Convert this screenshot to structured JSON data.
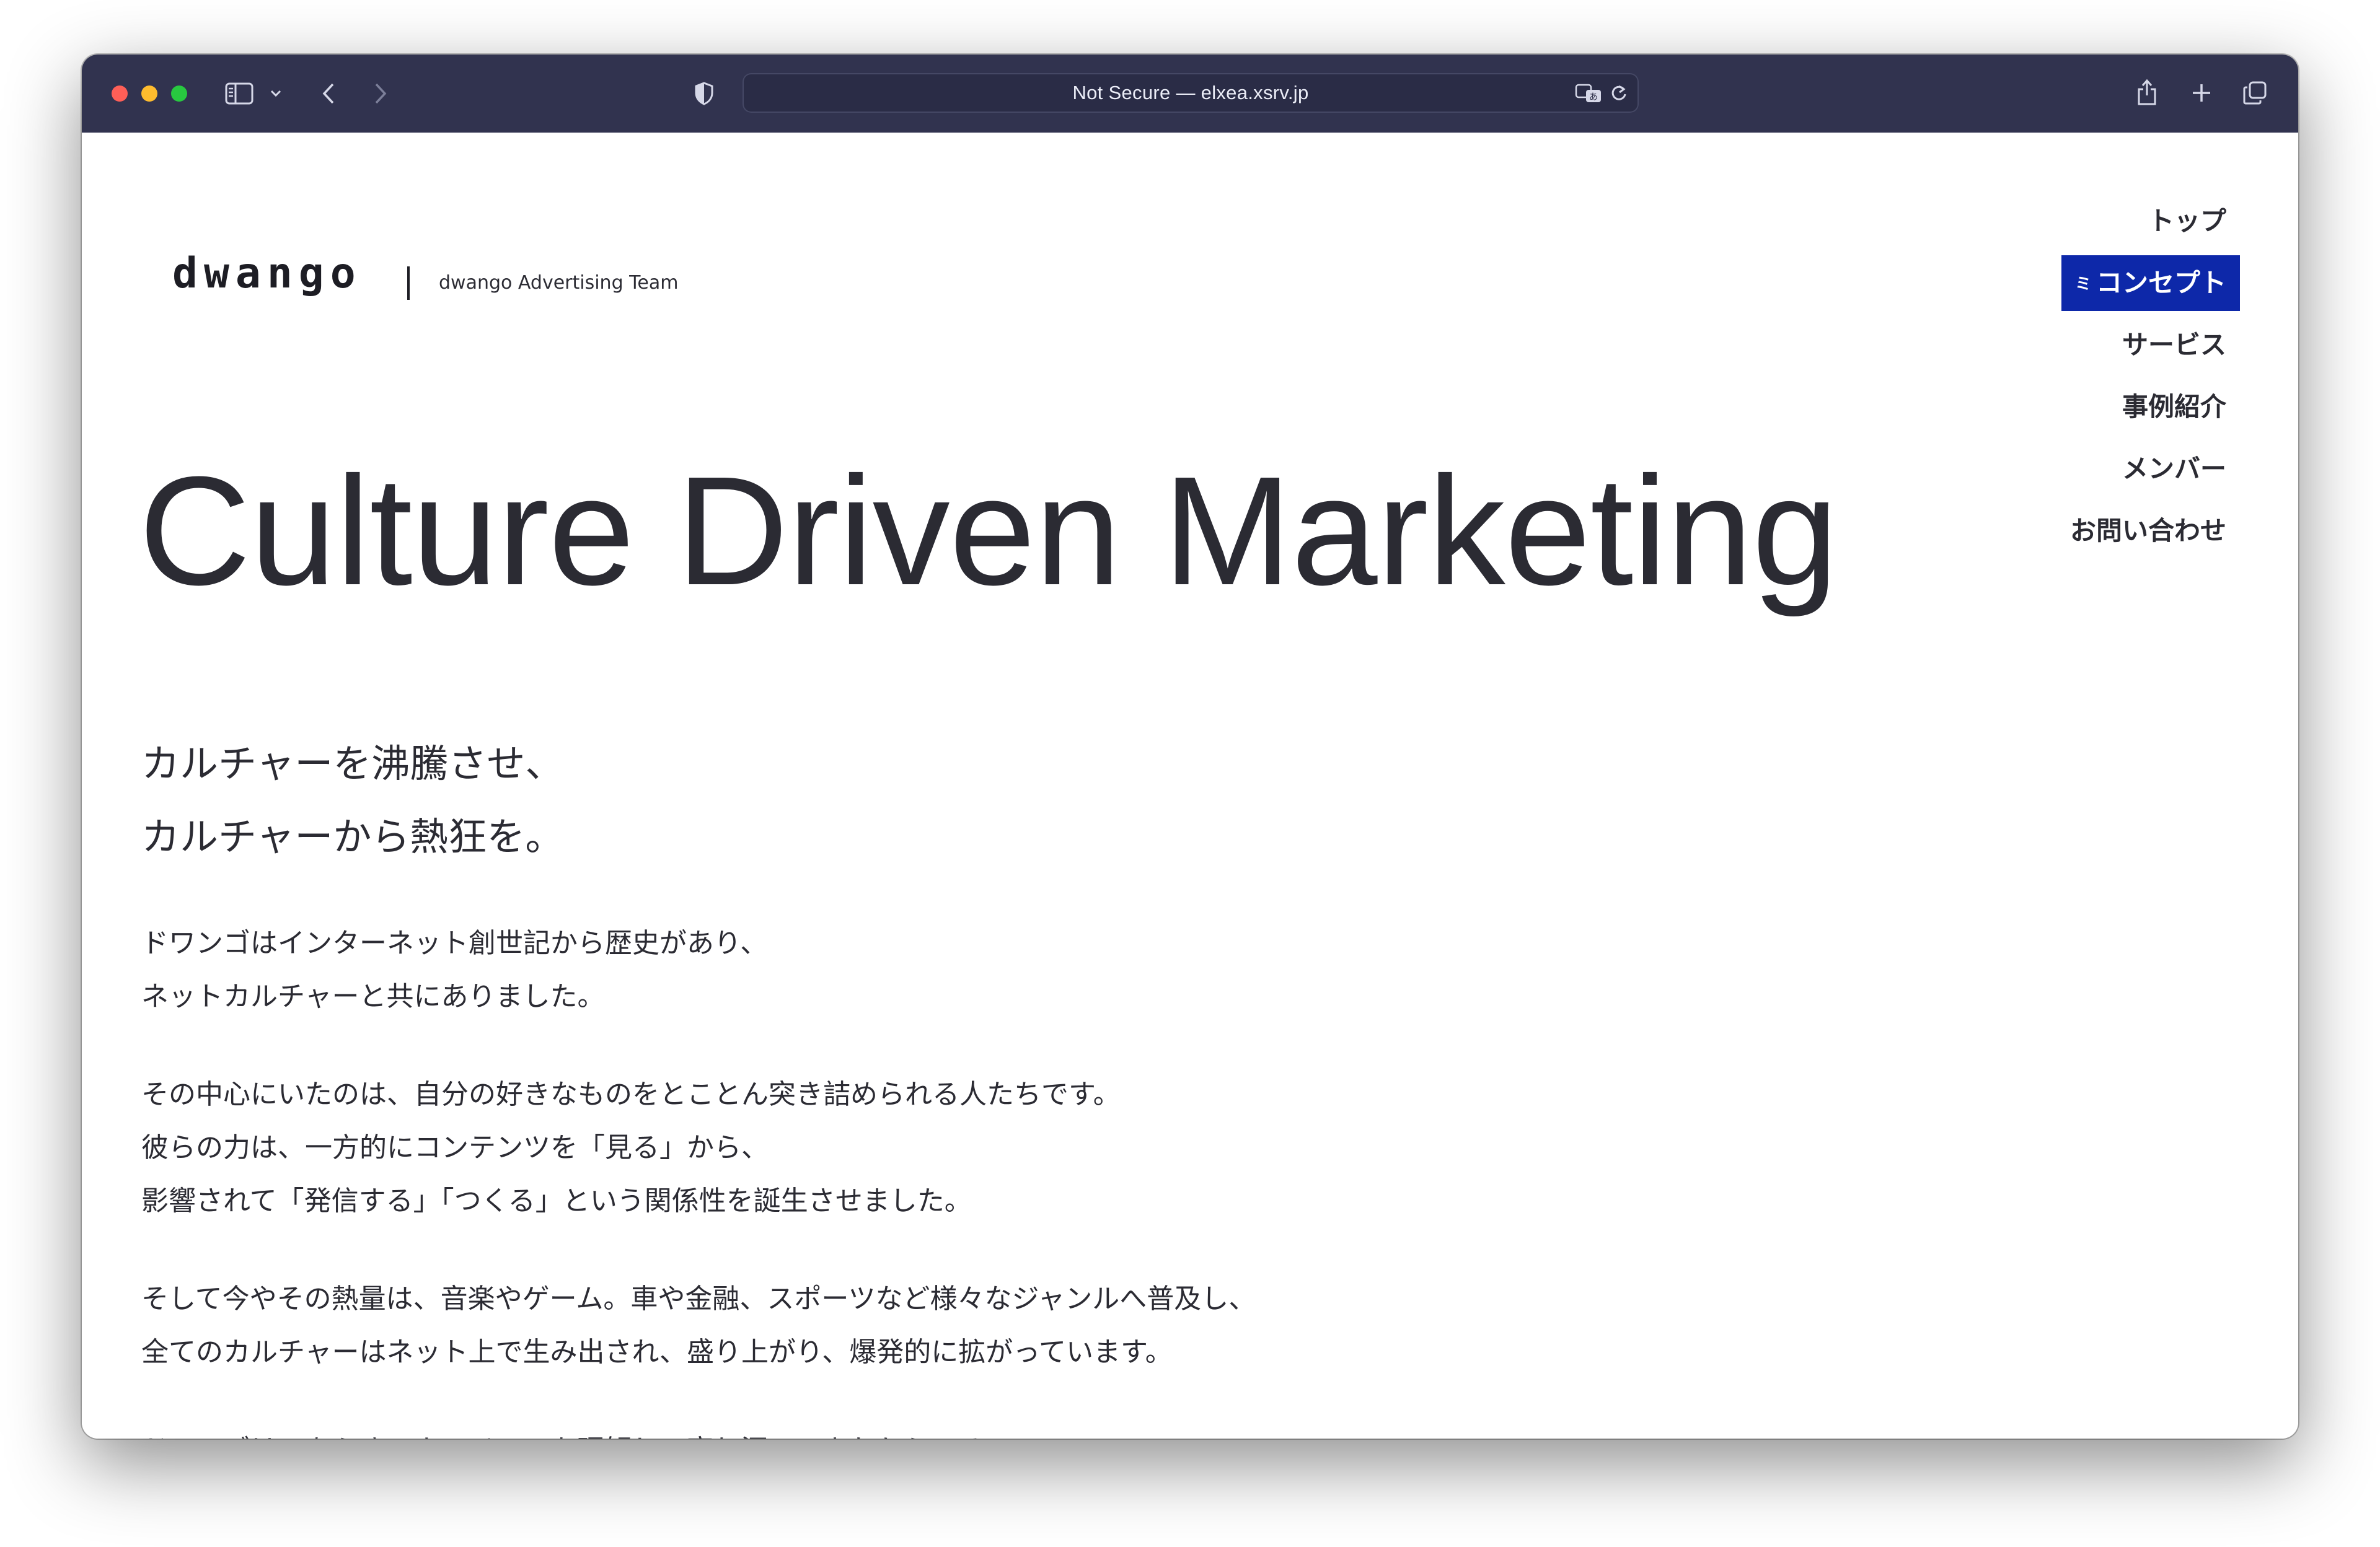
{
  "browser": {
    "address": "Not Secure — elxea.xsrv.jp",
    "icons": [
      "sidebar-icon",
      "chevron-down-icon",
      "back-icon",
      "forward-icon",
      "shield-icon",
      "translate-icon",
      "reload-icon",
      "share-icon",
      "plus-icon",
      "tabs-icon"
    ]
  },
  "site": {
    "logo": "dwango",
    "team": "dwango Advertising Team"
  },
  "nav": {
    "items": [
      {
        "label": "トップ"
      },
      {
        "label": "コンセプト",
        "active": true
      },
      {
        "label": "サービス"
      },
      {
        "label": "事例紹介"
      },
      {
        "label": "メンバー"
      },
      {
        "label": "お問い合わせ"
      }
    ],
    "active_marker": "ミ",
    "active_color": "#0d28a9"
  },
  "hero": {
    "title": "Culture Driven Marketing"
  },
  "lead": {
    "lines": [
      "カルチャーを沸騰させ、",
      "カルチャーから熱狂を。"
    ]
  },
  "body": {
    "paragraphs": [
      [
        "ドワンゴはインターネット創世記から歴史があり、",
        "ネットカルチャーと共にありました。"
      ],
      [
        "その中心にいたのは、自分の好きなものをとことん突き詰められる人たちです。",
        "彼らの力は、一方的にコンテンツを「見る」から、",
        "影響されて「発信する」「つくる」という関係性を誕生させました。"
      ],
      [
        "そして今やその熱量は、音楽やゲーム。車や金融、スポーツなど様々なジャンルへ普及し、",
        "全てのカルチャーはネット上で生み出され、盛り上がり、爆発的に拡がっています。"
      ],
      [
        "ドワンゴは、あらゆるカルチャーを理解し、寄り添ってきたからこそ"
      ]
    ]
  }
}
